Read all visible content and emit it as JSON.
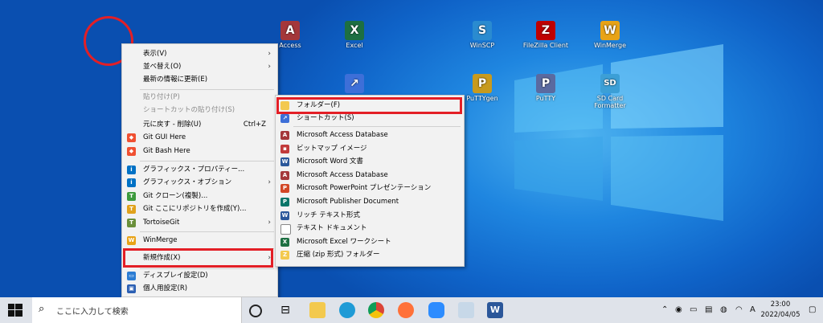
{
  "desktop_icons": [
    {
      "label": "Access",
      "color": "#a4373a",
      "glyph": "A"
    },
    {
      "label": "Excel",
      "color": "#1d6f42",
      "glyph": "X"
    },
    {
      "label": "WinSCP",
      "color": "#2a8bd0",
      "glyph": "S"
    },
    {
      "label": "FileZilla Client",
      "color": "#bf0000",
      "glyph": "Z"
    },
    {
      "label": "WinMerge",
      "color": "#e8a317",
      "glyph": "W"
    },
    {
      "label": "PuTTYgen",
      "color": "#c79a1e",
      "glyph": "P"
    },
    {
      "label": "PuTTY",
      "color": "#5a6aa0",
      "glyph": "P"
    },
    {
      "label": "SD Card Formatter",
      "color": "#3c9fd6",
      "glyph": "SD"
    }
  ],
  "main_menu": {
    "items": [
      {
        "label": "表示(V)"
      },
      {
        "label": "並べ替え(O)"
      },
      {
        "label": "最新の情報に更新(E)"
      },
      {
        "label": "貼り付け(P)"
      },
      {
        "label": "ショートカットの貼り付け(S)"
      },
      {
        "label": "元に戻す - 削除(U)",
        "shortcut": "Ctrl+Z"
      },
      {
        "label": "Git GUI Here"
      },
      {
        "label": "Git Bash Here"
      },
      {
        "label": "グラフィックス・プロパティー..."
      },
      {
        "label": "グラフィックス・オプション"
      },
      {
        "label": "Git クローン(複製)..."
      },
      {
        "label": "Git ここにリポジトリを作成(Y)..."
      },
      {
        "label": "TortoiseGit"
      },
      {
        "label": "WinMerge"
      },
      {
        "label": "新規作成(X)"
      },
      {
        "label": "ディスプレイ設定(D)"
      },
      {
        "label": "個人用設定(R)"
      }
    ]
  },
  "sub_menu": {
    "items": [
      {
        "label": "フォルダー(F)"
      },
      {
        "label": "ショートカット(S)"
      },
      {
        "label": "Microsoft Access Database"
      },
      {
        "label": "ビットマップ イメージ"
      },
      {
        "label": "Microsoft Word 文書"
      },
      {
        "label": "Microsoft Access Database"
      },
      {
        "label": "Microsoft PowerPoint プレゼンテーション"
      },
      {
        "label": "Microsoft Publisher Document"
      },
      {
        "label": "リッチ テキスト形式"
      },
      {
        "label": "テキスト ドキュメント"
      },
      {
        "label": "Microsoft Excel ワークシート"
      },
      {
        "label": "圧縮 (zip 形式) フォルダー"
      }
    ]
  },
  "taskbar": {
    "search_placeholder": "ここに入力して検索",
    "time": "23:00",
    "date": "2022/04/05",
    "ime": "A"
  }
}
